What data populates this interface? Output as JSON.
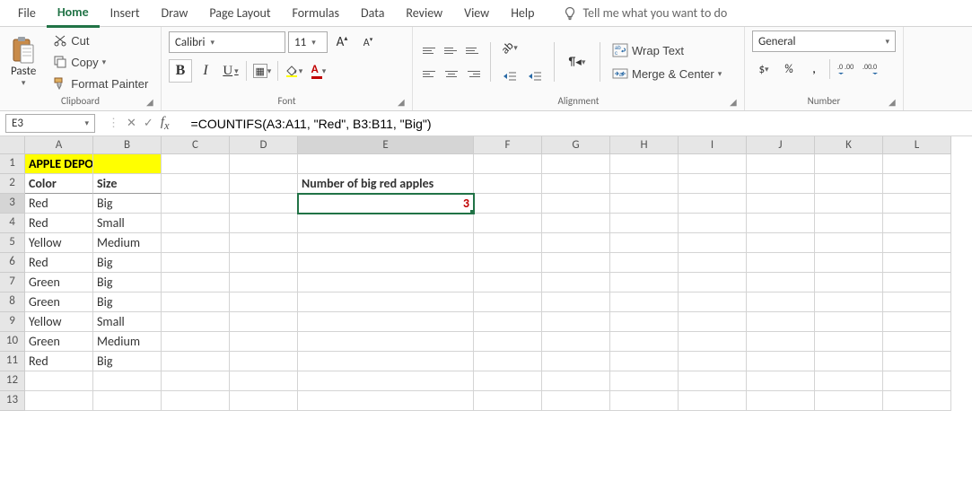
{
  "tabs": {
    "file": "File",
    "home": "Home",
    "insert": "Insert",
    "draw": "Draw",
    "pagelayout": "Page Layout",
    "formulas": "Formulas",
    "data": "Data",
    "review": "Review",
    "view": "View",
    "help": "Help",
    "tell": "Tell me what you want to do"
  },
  "ribbon": {
    "clipboard": {
      "paste": "Paste",
      "cut": "Cut",
      "copy": "Copy",
      "painter": "Format Painter",
      "label": "Clipboard"
    },
    "font": {
      "name": "Calibri",
      "size": "11",
      "label": "Font"
    },
    "alignment": {
      "wrap": "Wrap Text",
      "merge": "Merge & Center",
      "label": "Alignment"
    },
    "number": {
      "format": "General",
      "label": "Number"
    }
  },
  "formulaBar": {
    "nameBox": "E3",
    "formula": "=COUNTIFS(A3:A11, \"Red\", B3:B11, \"Big\")"
  },
  "columns": [
    "A",
    "B",
    "C",
    "D",
    "E",
    "F",
    "G",
    "H",
    "I",
    "J",
    "K",
    "L"
  ],
  "sheet": {
    "title": "APPLE DEPOSIT",
    "hColor": "Color",
    "hSize": "Size",
    "rows": [
      {
        "c": "Red",
        "s": "Big"
      },
      {
        "c": "Red",
        "s": "Small"
      },
      {
        "c": "Yellow",
        "s": "Medium"
      },
      {
        "c": "Red",
        "s": "Big"
      },
      {
        "c": "Green",
        "s": "Big"
      },
      {
        "c": "Green",
        "s": "Big"
      },
      {
        "c": "Yellow",
        "s": "Small"
      },
      {
        "c": "Green",
        "s": "Medium"
      },
      {
        "c": "Red",
        "s": "Big"
      }
    ],
    "resultLabel": "Number of big red apples",
    "resultValue": "3"
  }
}
